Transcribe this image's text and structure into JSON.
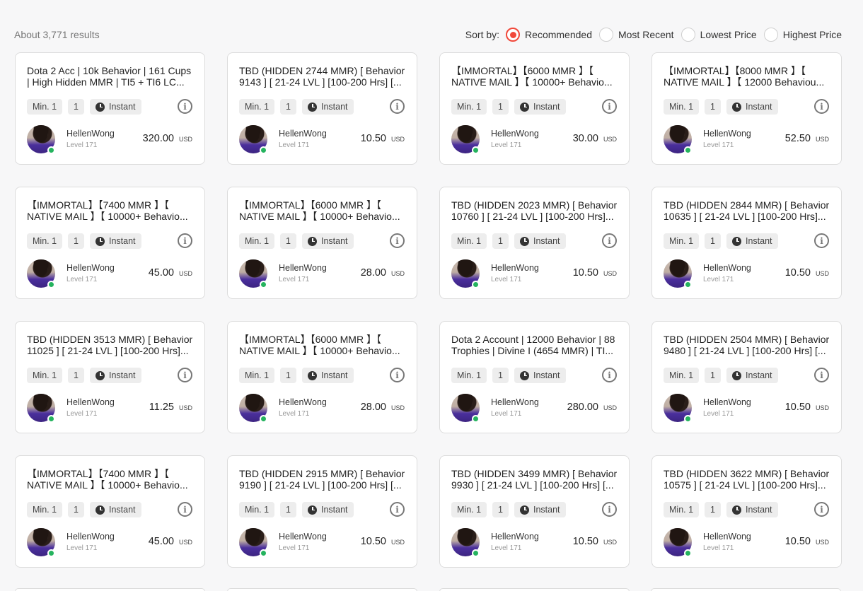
{
  "header": {
    "results_text": "About 3,771 results",
    "sort_label": "Sort by:",
    "sort_options": [
      {
        "label": "Recommended",
        "selected": true
      },
      {
        "label": "Most Recent",
        "selected": false
      },
      {
        "label": "Lowest Price",
        "selected": false
      },
      {
        "label": "Highest Price",
        "selected": false
      }
    ]
  },
  "colors": {
    "accent": "#f1483a",
    "online": "#25b35e"
  },
  "listings": [
    {
      "title": "Dota 2 Acc | 10k Behavior | 161 Cups | High Hidden MMR | TI5 + TI6 LC...",
      "min": "Min. 1",
      "qty": "1",
      "delivery": "Instant",
      "seller": "HellenWong",
      "level": "Level 171",
      "price": "320.00",
      "currency": "USD"
    },
    {
      "title": "TBD (HIDDEN 2744 MMR) [ Behavior 9143 ] [ 21-24 LVL ] [100-200 Hrs] [...",
      "min": "Min. 1",
      "qty": "1",
      "delivery": "Instant",
      "seller": "HellenWong",
      "level": "Level 171",
      "price": "10.50",
      "currency": "USD"
    },
    {
      "title": "【IMMORTAL】【6000 MMR 】【 NATIVE MAIL 】【 10000+ Behavio...",
      "min": "Min. 1",
      "qty": "1",
      "delivery": "Instant",
      "seller": "HellenWong",
      "level": "Level 171",
      "price": "30.00",
      "currency": "USD"
    },
    {
      "title": "【IMMORTAL】【8000 MMR 】【 NATIVE MAIL 】【 12000 Behaviou...",
      "min": "Min. 1",
      "qty": "1",
      "delivery": "Instant",
      "seller": "HellenWong",
      "level": "Level 171",
      "price": "52.50",
      "currency": "USD"
    },
    {
      "title": "【IMMORTAL】【7400 MMR 】【 NATIVE MAIL 】【 10000+ Behavio...",
      "min": "Min. 1",
      "qty": "1",
      "delivery": "Instant",
      "seller": "HellenWong",
      "level": "Level 171",
      "price": "45.00",
      "currency": "USD"
    },
    {
      "title": "【IMMORTAL】【6000 MMR 】【 NATIVE MAIL 】【 10000+ Behavio...",
      "min": "Min. 1",
      "qty": "1",
      "delivery": "Instant",
      "seller": "HellenWong",
      "level": "Level 171",
      "price": "28.00",
      "currency": "USD"
    },
    {
      "title": "TBD (HIDDEN 2023 MMR) [ Behavior 10760 ] [ 21-24 LVL ] [100-200 Hrs]...",
      "min": "Min. 1",
      "qty": "1",
      "delivery": "Instant",
      "seller": "HellenWong",
      "level": "Level 171",
      "price": "10.50",
      "currency": "USD"
    },
    {
      "title": "TBD (HIDDEN 2844 MMR) [ Behavior 10635 ] [ 21-24 LVL ] [100-200 Hrs]...",
      "min": "Min. 1",
      "qty": "1",
      "delivery": "Instant",
      "seller": "HellenWong",
      "level": "Level 171",
      "price": "10.50",
      "currency": "USD"
    },
    {
      "title": "TBD (HIDDEN 3513 MMR) [ Behavior 11025 ] [ 21-24 LVL ] [100-200 Hrs]...",
      "min": "Min. 1",
      "qty": "1",
      "delivery": "Instant",
      "seller": "HellenWong",
      "level": "Level 171",
      "price": "11.25",
      "currency": "USD"
    },
    {
      "title": "【IMMORTAL】【6000 MMR 】【 NATIVE MAIL 】【 10000+ Behavio...",
      "min": "Min. 1",
      "qty": "1",
      "delivery": "Instant",
      "seller": "HellenWong",
      "level": "Level 171",
      "price": "28.00",
      "currency": "USD"
    },
    {
      "title": "Dota 2 Account | 12000 Behavior | 88 Trophies | Divine I (4654 MMR) | TI...",
      "min": "Min. 1",
      "qty": "1",
      "delivery": "Instant",
      "seller": "HellenWong",
      "level": "Level 171",
      "price": "280.00",
      "currency": "USD"
    },
    {
      "title": "TBD (HIDDEN 2504 MMR) [ Behavior 9480 ] [ 21-24 LVL ] [100-200 Hrs] [...",
      "min": "Min. 1",
      "qty": "1",
      "delivery": "Instant",
      "seller": "HellenWong",
      "level": "Level 171",
      "price": "10.50",
      "currency": "USD"
    },
    {
      "title": "【IMMORTAL】【7400 MMR 】【 NATIVE MAIL 】【 10000+ Behavio...",
      "min": "Min. 1",
      "qty": "1",
      "delivery": "Instant",
      "seller": "HellenWong",
      "level": "Level 171",
      "price": "45.00",
      "currency": "USD"
    },
    {
      "title": "TBD (HIDDEN 2915 MMR) [ Behavior 9190 ] [ 21-24 LVL ] [100-200 Hrs] [...",
      "min": "Min. 1",
      "qty": "1",
      "delivery": "Instant",
      "seller": "HellenWong",
      "level": "Level 171",
      "price": "10.50",
      "currency": "USD"
    },
    {
      "title": "TBD (HIDDEN 3499 MMR) [ Behavior 9930 ] [ 21-24 LVL ] [100-200 Hrs] [...",
      "min": "Min. 1",
      "qty": "1",
      "delivery": "Instant",
      "seller": "HellenWong",
      "level": "Level 171",
      "price": "10.50",
      "currency": "USD"
    },
    {
      "title": "TBD (HIDDEN 3622 MMR) [ Behavior 10575 ] [ 21-24 LVL ] [100-200 Hrs]...",
      "min": "Min. 1",
      "qty": "1",
      "delivery": "Instant",
      "seller": "HellenWong",
      "level": "Level 171",
      "price": "10.50",
      "currency": "USD"
    }
  ]
}
